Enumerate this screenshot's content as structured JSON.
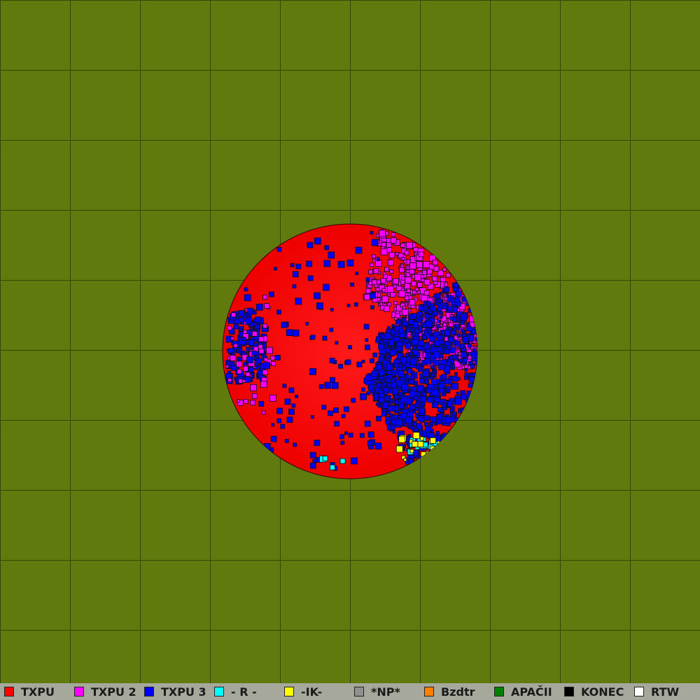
{
  "map": {
    "background_color": "#617a0e",
    "grid_color": "#2f4a06",
    "grid_cells": 10,
    "territories": [
      {
        "name": "TXPU",
        "color": "#ff0000"
      },
      {
        "name": "TXPU 2",
        "color": "#ff00ff"
      },
      {
        "name": "TXPU 3",
        "color": "#0000ff"
      },
      {
        "name": "- R -",
        "color": "#00ffff"
      },
      {
        "name": "-IK-",
        "color": "#ffff00"
      }
    ]
  },
  "legend": [
    {
      "label": "TXPU",
      "color": "#ff0000"
    },
    {
      "label": "TXPU 2",
      "color": "#ff00ff"
    },
    {
      "label": "TXPU 3",
      "color": "#0000ff"
    },
    {
      "label": "- R -",
      "color": "#00ffff"
    },
    {
      "label": "-IK-",
      "color": "#ffff00"
    },
    {
      "label": "*NP*",
      "color": "#909090"
    },
    {
      "label": "Bzdtr",
      "color": "#ff8000"
    },
    {
      "label": "APAČII",
      "color": "#008000"
    },
    {
      "label": "KONEC",
      "color": "#000000"
    },
    {
      "label": "RTW",
      "color": "#ffffff"
    }
  ]
}
